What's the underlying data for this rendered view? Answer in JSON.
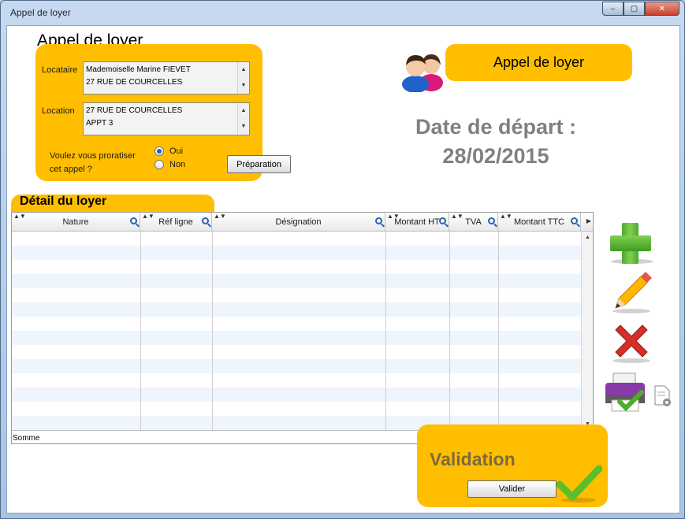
{
  "window": {
    "title": "Appel de loyer",
    "controls": {
      "minimize": "–",
      "maximize": "▢",
      "close": "✕"
    }
  },
  "form": {
    "title": "Appel de loyer",
    "locataire": {
      "label": "Locataire",
      "line1": "Mademoiselle Marine FIEVET",
      "line2": "27 RUE DE COURCELLES"
    },
    "location": {
      "label": "Location",
      "line1": "27 RUE DE COURCELLES",
      "line2": "APPT 3"
    },
    "prorata": {
      "question_line1": "Voulez vous proratiser",
      "question_line2": "cet appel ?",
      "options": [
        "Oui",
        "Non"
      ],
      "selected": "Oui"
    },
    "preparation_button": "Préparation"
  },
  "header": {
    "title": "Appel de loyer",
    "date_line1": "Date de départ :",
    "date_line2": "28/02/2015"
  },
  "detail": {
    "title": "Détail du loyer",
    "columns": [
      "Nature",
      "Réf ligne",
      "Désignation",
      "Montant HT",
      "TVA",
      "Montant TTC"
    ],
    "rows": [],
    "footer": "Somme"
  },
  "validation": {
    "title": "Validation",
    "button": "Valider"
  },
  "actions": [
    "add-icon",
    "edit-pencil-icon",
    "delete-icon",
    "print-validate-icon",
    "document-settings-icon"
  ],
  "colors": {
    "accent": "#ffbe00",
    "grid_alt_row": "#eef5fd",
    "date_text": "#808080",
    "validation_text": "#7b6a3e"
  }
}
